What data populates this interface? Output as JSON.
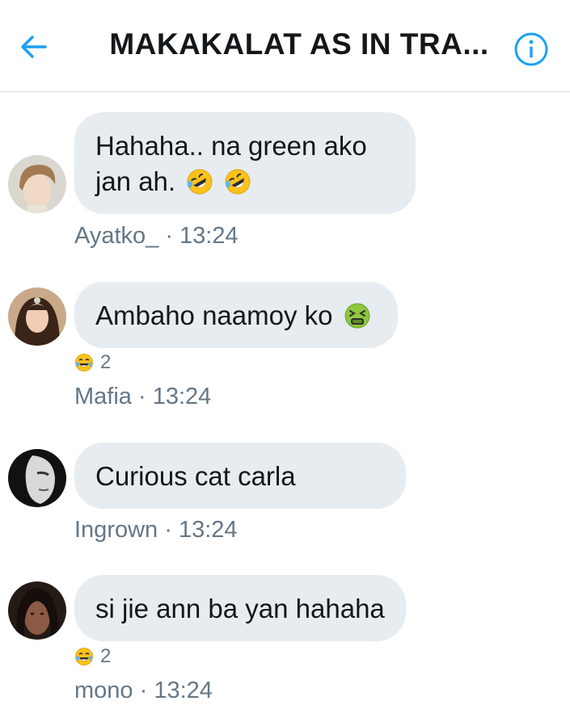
{
  "header": {
    "title": "MAKAKALAT AS IN TRA...",
    "back_icon": "arrow-left-icon",
    "info_icon": "info-circle-icon",
    "accent_color": "#1da1f2"
  },
  "messages": [
    {
      "text_line1": "Hahaha.. na green ako",
      "text_line2": "jan ah.",
      "emojis": [
        "rolling-on-floor-laughing-emoji",
        "rolling-on-floor-laughing-emoji"
      ],
      "sender": "Ayatko_",
      "time": "13:24"
    },
    {
      "text": "Ambaho naamoy ko",
      "emojis": [
        "nauseated-face-emoji"
      ],
      "reaction": {
        "icon": "joy-emoji",
        "count": "2"
      },
      "sender": "Mafia",
      "time": "13:24"
    },
    {
      "text": "Curious cat carla",
      "sender": "Ingrown",
      "time": "13:24"
    },
    {
      "text": "si jie ann ba yan hahaha",
      "reaction": {
        "icon": "joy-emoji",
        "count": "2"
      },
      "sender": "mono",
      "time": "13:24"
    }
  ],
  "separator": " · "
}
